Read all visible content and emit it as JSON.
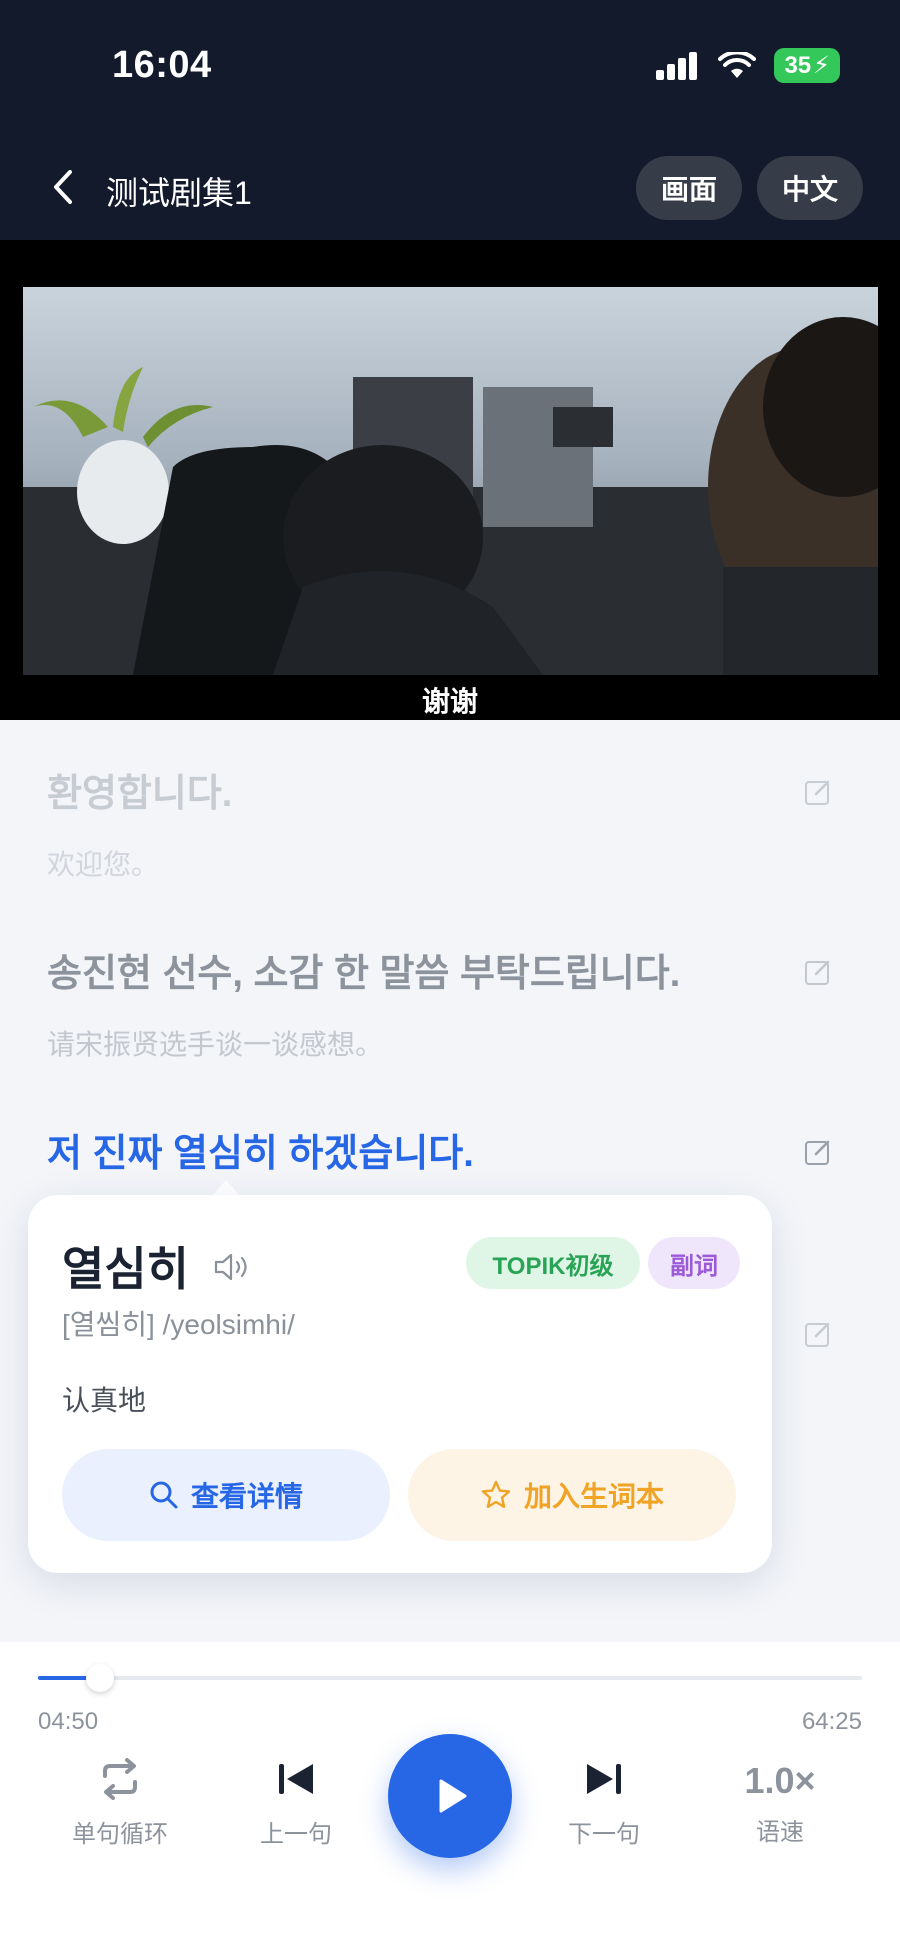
{
  "status": {
    "time": "16:04",
    "battery": "35"
  },
  "header": {
    "title": "测试剧集1",
    "screen_btn": "画面",
    "lang_btn": "中文"
  },
  "video": {
    "subtitle": "谢谢"
  },
  "transcript": [
    {
      "ko": "환영합니다.",
      "zh": "欢迎您。"
    },
    {
      "ko": "송진현 선수, 소감 한 말씀 부탁드립니다.",
      "zh": "请宋振贤选手谈一谈感想。"
    },
    {
      "ko": "저 진짜 열심히 하겠습니다.",
      "zh": ""
    }
  ],
  "popup": {
    "word": "열심히",
    "level_tag": "TOPIK初级",
    "pos_tag": "副词",
    "pronunciation": "[열씸히]  /yeolsimhi/",
    "meaning": "认真地",
    "detail_btn": "查看详情",
    "add_btn": "加入生词本"
  },
  "player": {
    "current_time": "04:50",
    "total_time": "64:25",
    "progress_pct": 7.5,
    "loop_label": "单句循环",
    "prev_label": "上一句",
    "next_label": "下一句",
    "speed_value": "1.0×",
    "speed_label": "语速"
  },
  "colors": {
    "accent": "#2767e6",
    "header_bg": "#121a2c",
    "level_green": "#29a356",
    "pos_purple": "#9b5ad8",
    "add_orange": "#f0a324"
  }
}
